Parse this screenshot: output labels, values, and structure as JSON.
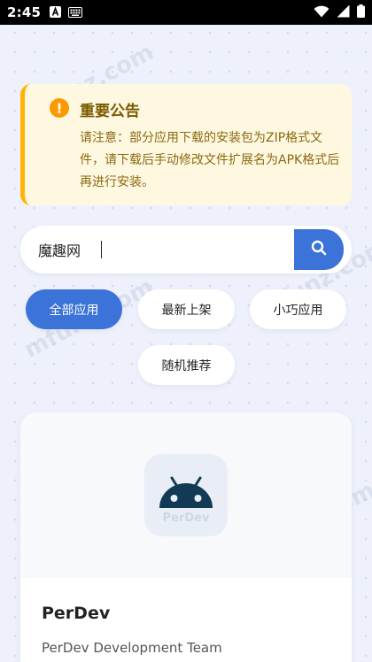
{
  "status_bar": {
    "time": "2:45"
  },
  "watermark_text": "mfunz.com",
  "notice": {
    "icon": "!",
    "title": "重要公告",
    "body": "请注意：部分应用下载的安装包为ZIP格式文件，请下载后手动修改文件扩展名为APK格式后再进行安装。"
  },
  "search": {
    "value": "魔趣网"
  },
  "filters": {
    "all": "全部应用",
    "newest": "最新上架",
    "small": "小巧应用",
    "random": "随机推荐"
  },
  "app_card": {
    "icon_text": "PerDev",
    "name": "PerDev",
    "developer": "PerDev Development Team"
  },
  "colors": {
    "accent": "#3b73d8",
    "notice_bg": "#fff8e1",
    "notice_border": "#ffb300",
    "notice_icon": "#ff9800",
    "android_icon": "#123a55"
  }
}
